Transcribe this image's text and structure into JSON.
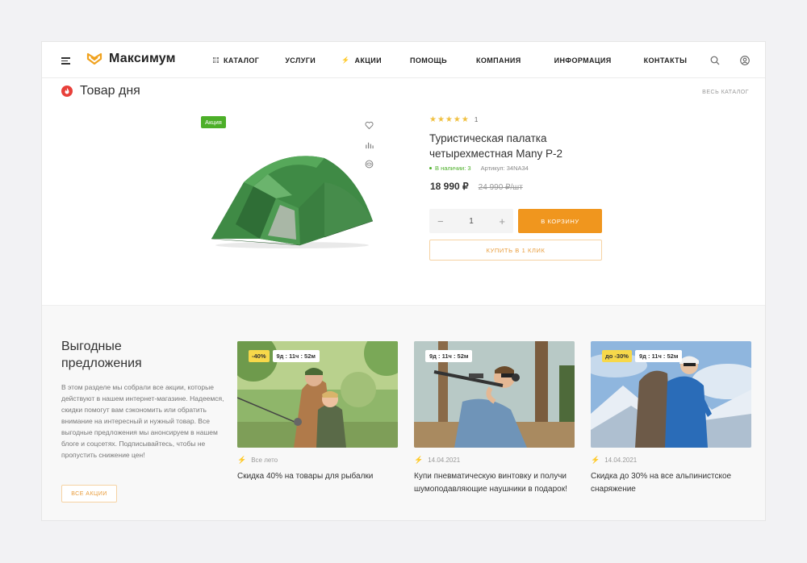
{
  "header": {
    "logo_text": "Максимум",
    "nav": [
      {
        "label": "КАТАЛОГ",
        "icon": "grid-icon"
      },
      {
        "label": "УСЛУГИ"
      },
      {
        "label": "АКЦИИ",
        "icon": "bolt-icon"
      },
      {
        "label": "ПОМОЩЬ"
      },
      {
        "label": "КОМПАНИЯ"
      },
      {
        "label": "ИНФОРМАЦИЯ"
      },
      {
        "label": "КОНТАКТЫ"
      }
    ]
  },
  "product_of_day": {
    "title": "Товар дня",
    "all_catalog": "ВЕСЬ КАТАЛОГ",
    "badge": "Акция",
    "rating": 5,
    "rating_stars": "★★★★★",
    "rating_count": "1",
    "name": "Туристическая палатка четырехместная Many P-2",
    "stock": "В наличии: 3",
    "sku": "Артикул: 34NA34",
    "price": "18 990 ₽",
    "old_price": "24 990 ₽/шт",
    "quantity": "1",
    "qty_minus": "−",
    "qty_plus": "+",
    "to_cart": "В КОРЗИНУ",
    "one_click": "КУПИТЬ В 1 КЛИК"
  },
  "offers": {
    "title": "Выгодные предложения",
    "description": "В этом разделе мы собрали все акции, которые действуют в нашем интернет-магазине. Надеемся, скидки помогут вам сэкономить или обратить внимание на интересный и нужный товар. Все выгодные предложения мы анонсируем в нашем блоге и соцсетях. Подписывайтесь, чтобы не пропустить снижение цен!",
    "all_button": "ВСЕ АКЦИИ",
    "cards": [
      {
        "discount": "-40%",
        "timer": "9д : 11ч : 52м",
        "date": "Все лето",
        "text": "Скидка 40% на товары для рыбалки"
      },
      {
        "discount": "",
        "timer": "9д : 11ч : 52м",
        "date": "14.04.2021",
        "text": "Купи пневматическую винтовку и получи шумоподавляющие наушники в подарок!"
      },
      {
        "discount": "до -30%",
        "timer": "9д : 11ч : 52м",
        "date": "14.04.2021",
        "text": "Скидка до 30% на все альпинистское снаряжение"
      }
    ]
  },
  "colors": {
    "accent": "#f0961e",
    "promo_green": "#4caf28",
    "discount_yellow": "#f7d84a",
    "bolt_red": "#e8403a"
  }
}
